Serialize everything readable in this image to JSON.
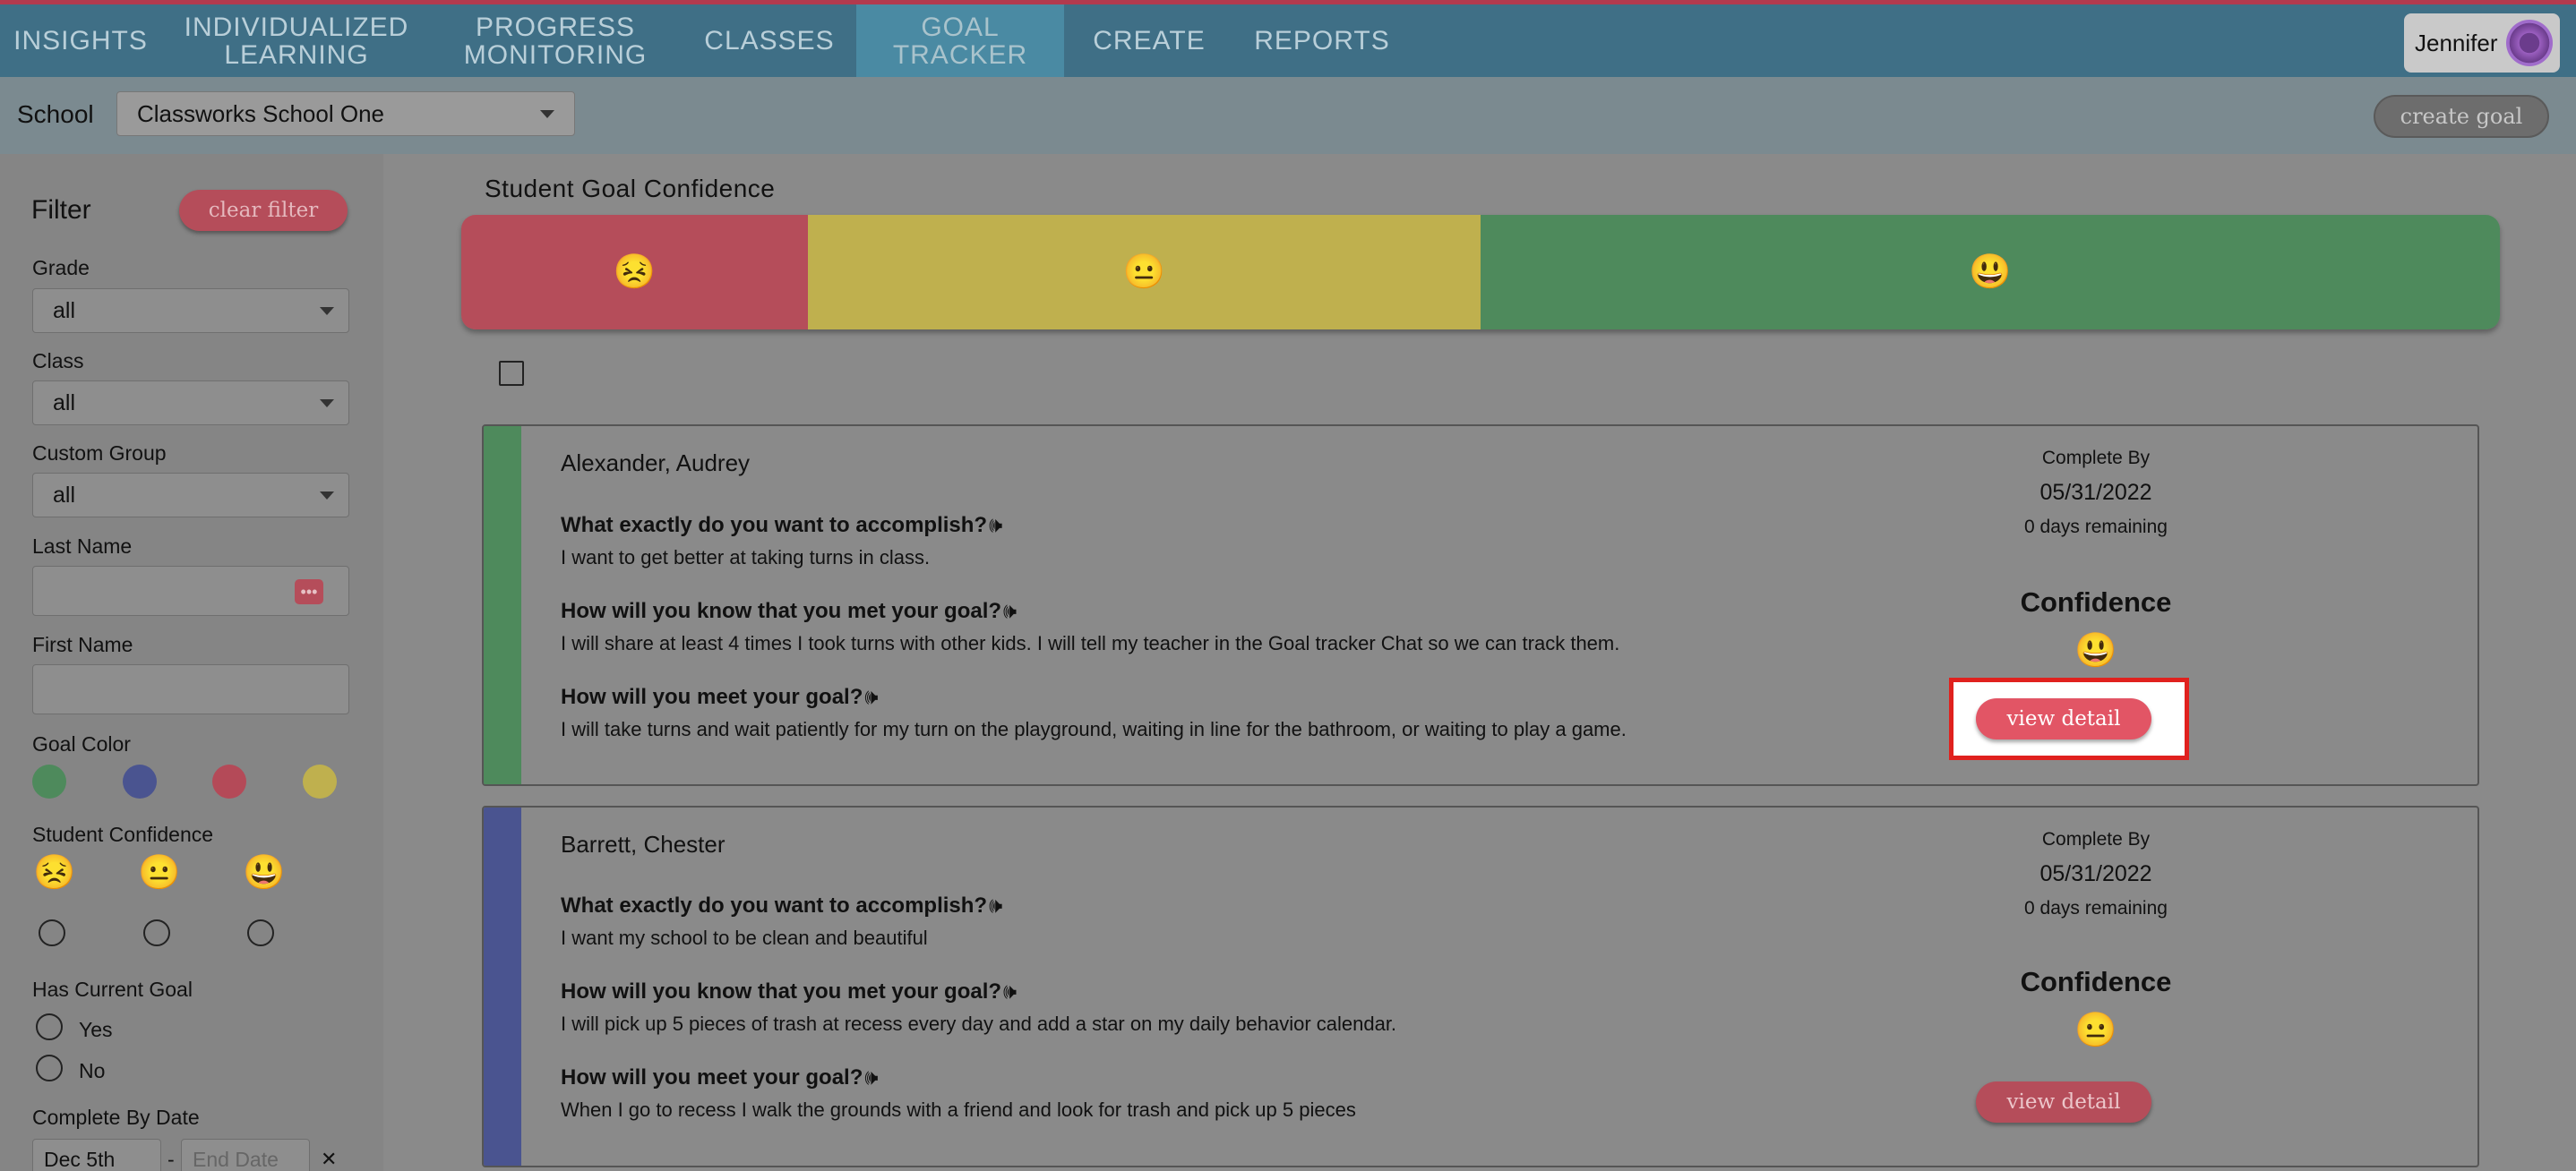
{
  "nav": {
    "items": [
      {
        "label": "INSIGHTS"
      },
      {
        "label": "INDIVIDUALIZED LEARNING"
      },
      {
        "label": "PROGRESS MONITORING"
      },
      {
        "label": "CLASSES"
      },
      {
        "label": "GOAL TRACKER"
      },
      {
        "label": "CREATE"
      },
      {
        "label": "REPORTS"
      }
    ],
    "active": "GOAL TRACKER",
    "user_name": "Jennifer"
  },
  "school_bar": {
    "label": "School",
    "selected_school": "Classworks School One",
    "create_goal_label": "create goal"
  },
  "filter": {
    "title": "Filter",
    "clear_label": "clear filter",
    "grade_label": "Grade",
    "grade_value": "all",
    "class_label": "Class",
    "class_value": "all",
    "custom_group_label": "Custom Group",
    "custom_group_value": "all",
    "last_name_label": "Last Name",
    "first_name_label": "First Name",
    "goal_color_label": "Goal Color",
    "goal_colors": [
      "#4e8a5c",
      "#4a5490",
      "#b44a58",
      "#bfb04e"
    ],
    "student_confidence_label": "Student Confidence",
    "confidence_emojis": [
      "😣",
      "😐",
      "😃"
    ],
    "has_current_goal_label": "Has Current Goal",
    "yes_label": "Yes",
    "no_label": "No",
    "complete_by_date_label": "Complete By Date",
    "start_date_value": "Dec 5th",
    "date_separator": "-",
    "end_date_placeholder": "End Date",
    "clear_date_glyph": "✕"
  },
  "main": {
    "title": "Student Goal Confidence",
    "confidence_segments": [
      {
        "emoji": "😣",
        "color": "#b54d5a"
      },
      {
        "emoji": "😐",
        "color": "#bfb04e"
      },
      {
        "emoji": "😃",
        "color": "#4e8a5c"
      }
    ]
  },
  "cards": [
    {
      "name": "Alexander, Audrey",
      "stripe_color": "#4e8a5c",
      "q1": "What exactly do you want to accomplish?",
      "a1": "I want to get better at taking turns in class.",
      "q2": "How will you know that you met your goal?",
      "a2": "I will share at least 4 times I took turns with other kids. I will tell my teacher in the Goal tracker Chat so we can track them.",
      "q3": "How will you meet your goal?",
      "a3": "I will take turns and wait patiently for my turn on the playground, waiting in line for the bathroom, or waiting to play a game.",
      "complete_by_label": "Complete By",
      "date": "05/31/2022",
      "days_remaining": "0 days remaining",
      "confidence_label": "Confidence",
      "confidence_emoji": "😃",
      "view_detail_label": "view detail"
    },
    {
      "name": "Barrett, Chester",
      "stripe_color": "#4a5490",
      "q1": "What exactly do you want to accomplish?",
      "a1": "I want my school to be clean and beautiful",
      "q2": "How will you know that you met your goal?",
      "a2": "I will pick up 5 pieces of trash at recess every day and add a star on my daily behavior calendar.",
      "q3": "How will you meet your goal?",
      "a3": "When I go to recess I walk the grounds with a friend and look for trash and pick up 5 pieces",
      "complete_by_label": "Complete By",
      "date": "05/31/2022",
      "days_remaining": "0 days remaining",
      "confidence_label": "Confidence",
      "confidence_emoji": "😐",
      "view_detail_label": "view detail"
    }
  ]
}
